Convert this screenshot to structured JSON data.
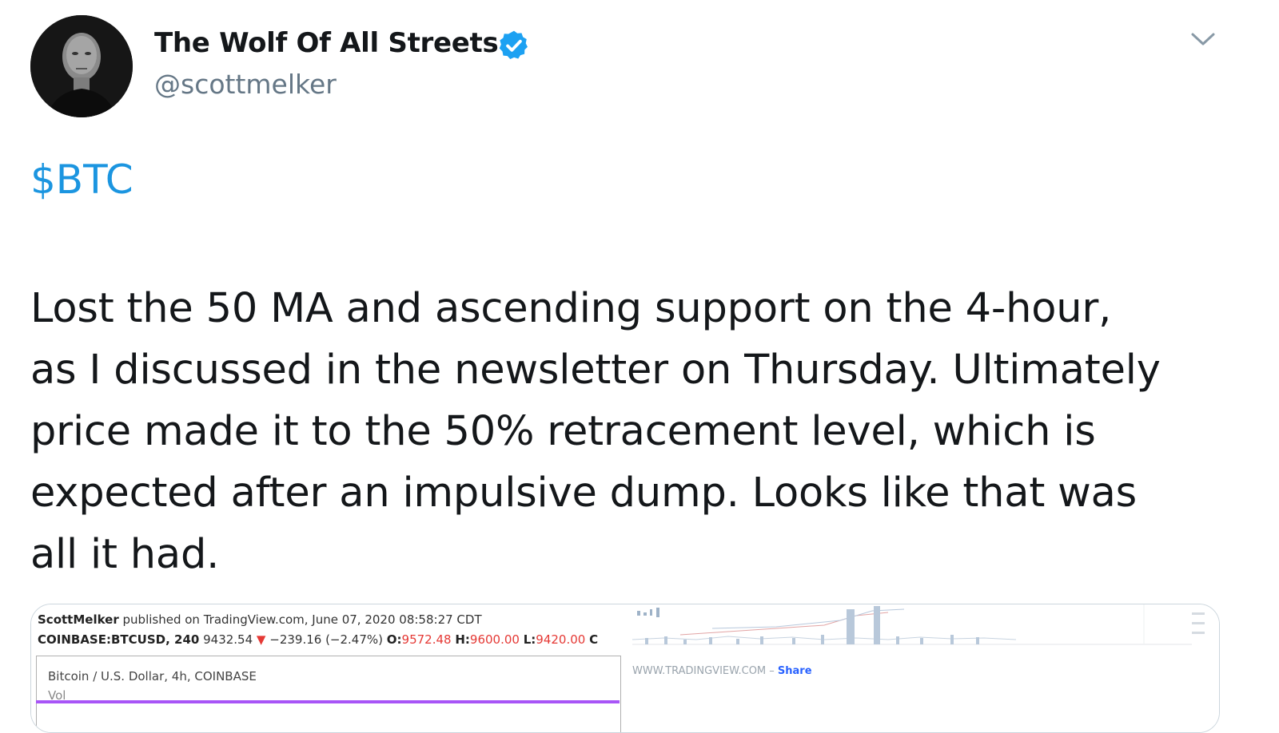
{
  "tweet": {
    "display_name": "The Wolf Of All Streets",
    "handle": "@scottmelker",
    "cashtag": "$BTC",
    "text_lines": [
      "Lost the 50 MA and ascending support on the 4-hour,",
      "as I discussed in the newsletter on Thursday. Ultimately",
      "price made it to the 50% retracement level, which is",
      "expected after an impulsive dump. Looks like that was",
      "all it had."
    ],
    "icons": {
      "verified": "verified-badge-icon",
      "caret": "chevron-down-icon"
    },
    "colors": {
      "link": "#1b95e0",
      "verified": "#1da1f2",
      "secondary": "#657786"
    }
  },
  "chart_card": {
    "publisher": "ScottMelker",
    "published_text": "published on TradingView.com, June 07, 2020 08:58:27 CDT",
    "symbol_line": {
      "symbol": "COINBASE:BTCUSD, 240",
      "price": "9432.54",
      "change_arrow": "▼",
      "change": "−239.16 (−2.47%)",
      "o_label": "O:",
      "o_value": "9572.48",
      "h_label": "H:",
      "h_value": "9600.00",
      "l_label": "L:",
      "l_value": "9420.00",
      "c_label": "C"
    },
    "chart_title": "Bitcoin / U.S. Dollar, 4h, COINBASE",
    "vol_label": "Vol",
    "footer_site": "WWW.TRADINGVIEW.COM –",
    "footer_share": "Share"
  }
}
